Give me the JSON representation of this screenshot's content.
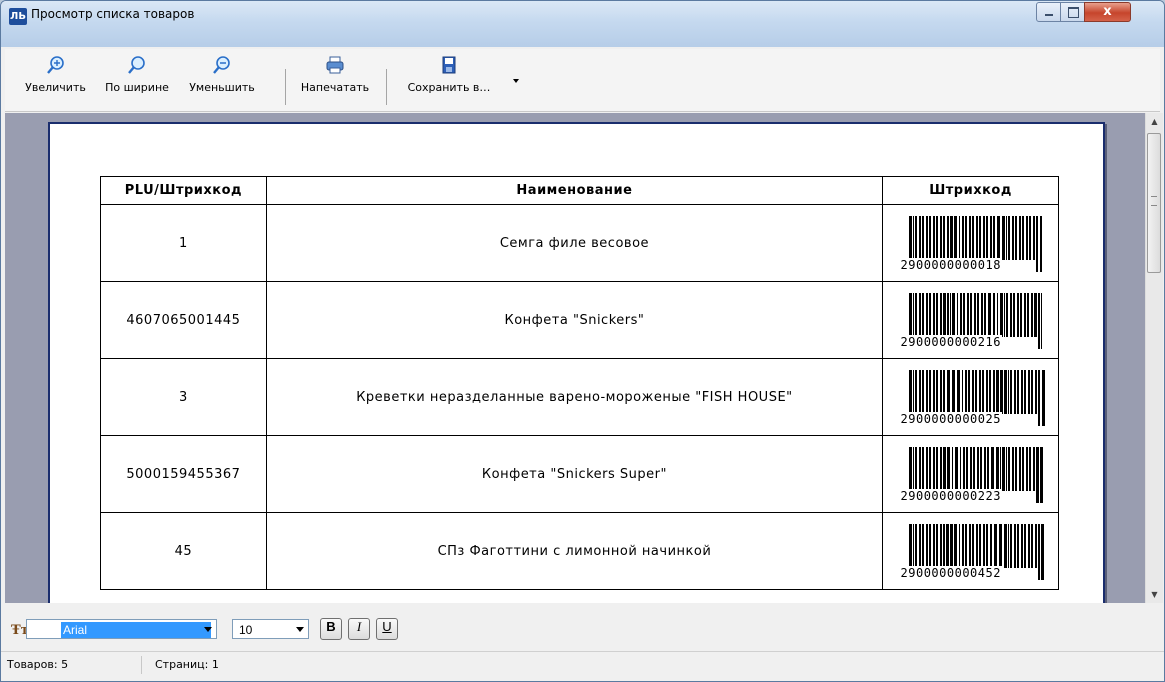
{
  "window": {
    "title": "Просмотр списка товаров",
    "app_icon_text": "ЛЬ",
    "close_glyph": "x"
  },
  "toolbar": {
    "zoom_in": "Увеличить",
    "fit_width": "По ширине",
    "zoom_out": "Уменьшить",
    "print": "Напечатать",
    "save_as": "Сохранить в…"
  },
  "table": {
    "headers": [
      "PLU/Штрихкод",
      "Наименование",
      "Штрихкод"
    ],
    "rows": [
      {
        "plu": "1",
        "name": "Семга филе весовое",
        "barcode": "2900000000018"
      },
      {
        "plu": "4607065001445",
        "name": "Конфета \"Snickers\"",
        "barcode": "2900000000216"
      },
      {
        "plu": "3",
        "name": "Креветки неразделанные  варено-мороженые \"FISH HOUSE\"",
        "barcode": "2900000000025"
      },
      {
        "plu": "5000159455367",
        "name": "Конфета \"Snickers Super\"",
        "barcode": "2900000000223"
      },
      {
        "plu": "45",
        "name": "СПз Фаготтини  с лимонной начинкой",
        "barcode": "2900000000452"
      }
    ]
  },
  "format": {
    "font_name": "Arial",
    "font_size": "10",
    "bold": "B",
    "italic": "I",
    "underline": "U"
  },
  "status": {
    "items_count": "Товаров: 5",
    "pages_count": "Страниц: 1"
  },
  "colors": {
    "page_border": "#1a2d6d",
    "preview_background": "#999db0",
    "selection": "#3399ff"
  }
}
